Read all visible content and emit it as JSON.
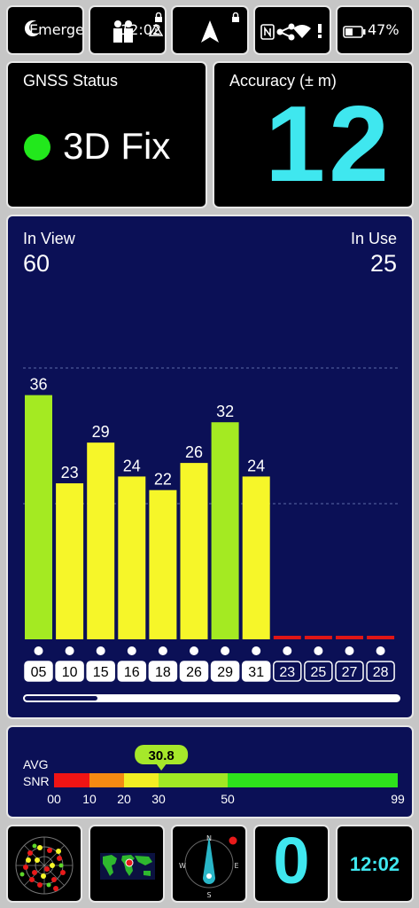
{
  "status_bar": {
    "emergency": "Emergen…",
    "time_fragment": "12:02",
    "battery_pct": "47%"
  },
  "gnss_status": {
    "title": "GNSS Status",
    "value": "3D Fix",
    "dot_color": "#22e81c"
  },
  "accuracy": {
    "title": "Accuracy (± m)",
    "value": "12",
    "color": "#3fe7ef"
  },
  "satellites": {
    "in_view_label": "In View",
    "in_view": "60",
    "in_use_label": "In Use",
    "in_use": "25"
  },
  "chart_data": {
    "type": "bar",
    "categories": [
      "05",
      "10",
      "15",
      "16",
      "18",
      "26",
      "29",
      "31",
      "23",
      "25",
      "27",
      "28"
    ],
    "values": [
      36,
      23,
      29,
      24,
      22,
      26,
      32,
      24,
      0,
      0,
      0,
      0
    ],
    "used": [
      true,
      true,
      true,
      true,
      true,
      true,
      true,
      true,
      false,
      false,
      false,
      false
    ],
    "ylim": [
      0,
      60
    ],
    "grid": true,
    "colors": {
      "high": "#a4ea22",
      "mid": "#f6f629",
      "low": "#e01616",
      "background": "#0b1056"
    }
  },
  "snr": {
    "label_line1": "AVG",
    "label_line2": "SNR",
    "average": 30.8,
    "average_text": "30.8",
    "max": 99,
    "ticks": [
      "00",
      "10",
      "20",
      "30",
      "50",
      "99"
    ],
    "segments": [
      {
        "from": 0,
        "to": 10,
        "color": "#f01414"
      },
      {
        "from": 10,
        "to": 20,
        "color": "#f58a12"
      },
      {
        "from": 20,
        "to": 30,
        "color": "#f3ee23"
      },
      {
        "from": 30,
        "to": 50,
        "color": "#a1e824"
      },
      {
        "from": 50,
        "to": 99,
        "color": "#2ee21c"
      }
    ]
  },
  "bottom_bar": {
    "compass_value": "0",
    "clock": "12:02",
    "compass_n": "N",
    "compass_e": "E",
    "compass_w": "W",
    "compass_s": "S"
  }
}
